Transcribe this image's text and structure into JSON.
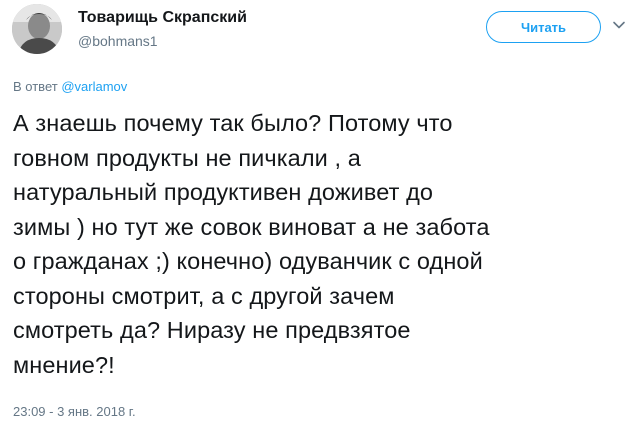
{
  "author": {
    "name": "Товарищь Скрапский",
    "handle": "@bohmans1"
  },
  "follow_button": {
    "label": "Читать"
  },
  "menu": {
    "icon": "chevron-down-icon"
  },
  "reply": {
    "prefix": "В ответ",
    "mention": "@varlamov"
  },
  "tweet": {
    "lines": [
      "А знаешь почему так было? Потому что",
      "говном продукты не пичкали , а",
      "натуральный продуктивен доживет до",
      "зимы ) но тут же совок виноват а не забота",
      "о гражданах ;) конечно) одуванчик с одной",
      "стороны смотрит, а с другой зачем",
      "смотреть да? Ниразу не предвзятое",
      "мнение?!"
    ],
    "timestamp": "23:09 - 3 янв. 2018 г."
  },
  "colors": {
    "accent": "#1da1f2",
    "secondary_text": "#657786",
    "primary_text": "#14171a"
  }
}
